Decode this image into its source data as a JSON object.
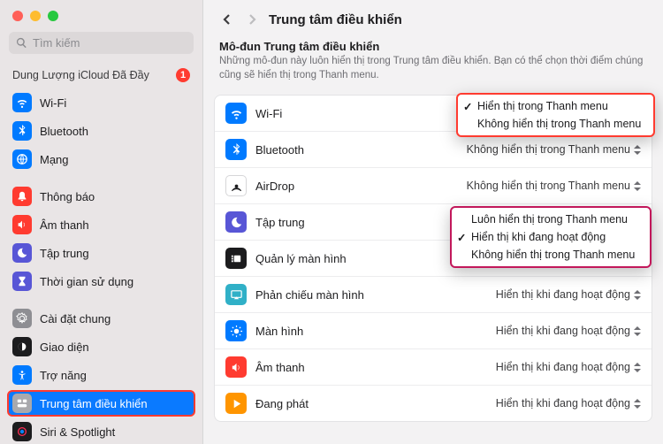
{
  "search": {
    "placeholder": "Tìm kiếm"
  },
  "sidebar": {
    "section_title": "Dung Lượng iCloud Đã Đầy",
    "badge": "1",
    "items": [
      {
        "label": "Wi-Fi"
      },
      {
        "label": "Bluetooth"
      },
      {
        "label": "Mạng"
      },
      {
        "label": "Thông báo"
      },
      {
        "label": "Âm thanh"
      },
      {
        "label": "Tập trung"
      },
      {
        "label": "Thời gian sử dụng"
      },
      {
        "label": "Cài đặt chung"
      },
      {
        "label": "Giao diện"
      },
      {
        "label": "Trợ năng"
      },
      {
        "label": "Trung tâm điều khiển"
      },
      {
        "label": "Siri & Spotlight"
      }
    ]
  },
  "page": {
    "title": "Trung tâm điều khiển",
    "heading": "Mô-đun Trung tâm điều khiển",
    "subtitle": "Những mô-đun này luôn hiển thị trong Trung tâm điều khiển. Bạn có thể chọn thời điểm chúng cũng sẽ hiển thị trong Thanh menu."
  },
  "rows": [
    {
      "label": "Wi-Fi",
      "value": "Hiển thị trong Thanh menu"
    },
    {
      "label": "Bluetooth",
      "value": "Không hiển thị trong Thanh menu"
    },
    {
      "label": "AirDrop",
      "value": "Không hiển thị trong Thanh menu"
    },
    {
      "label": "Tập trung",
      "value": "Không hiển thị trong Thanh menu"
    },
    {
      "label": "Quản lý màn hình",
      "value": "Hiển thị khi đang hoạt động"
    },
    {
      "label": "Phản chiếu màn hình",
      "value": "Hiển thị khi đang hoạt động"
    },
    {
      "label": "Màn hình",
      "value": "Hiển thị khi đang hoạt động"
    },
    {
      "label": "Âm thanh",
      "value": "Hiển thị khi đang hoạt động"
    },
    {
      "label": "Đang phát",
      "value": "Hiển thị khi đang hoạt động"
    }
  ],
  "popupA": {
    "opts": [
      {
        "label": "Hiển thị trong Thanh menu",
        "checked": true
      },
      {
        "label": "Không hiển thị trong Thanh menu",
        "checked": false
      }
    ]
  },
  "popupB": {
    "opts": [
      {
        "label": "Luôn hiển thị trong Thanh menu",
        "checked": false
      },
      {
        "label": "Hiển thị khi đang hoạt động",
        "checked": true
      },
      {
        "label": "Không hiển thị trong Thanh menu",
        "checked": false
      }
    ]
  }
}
